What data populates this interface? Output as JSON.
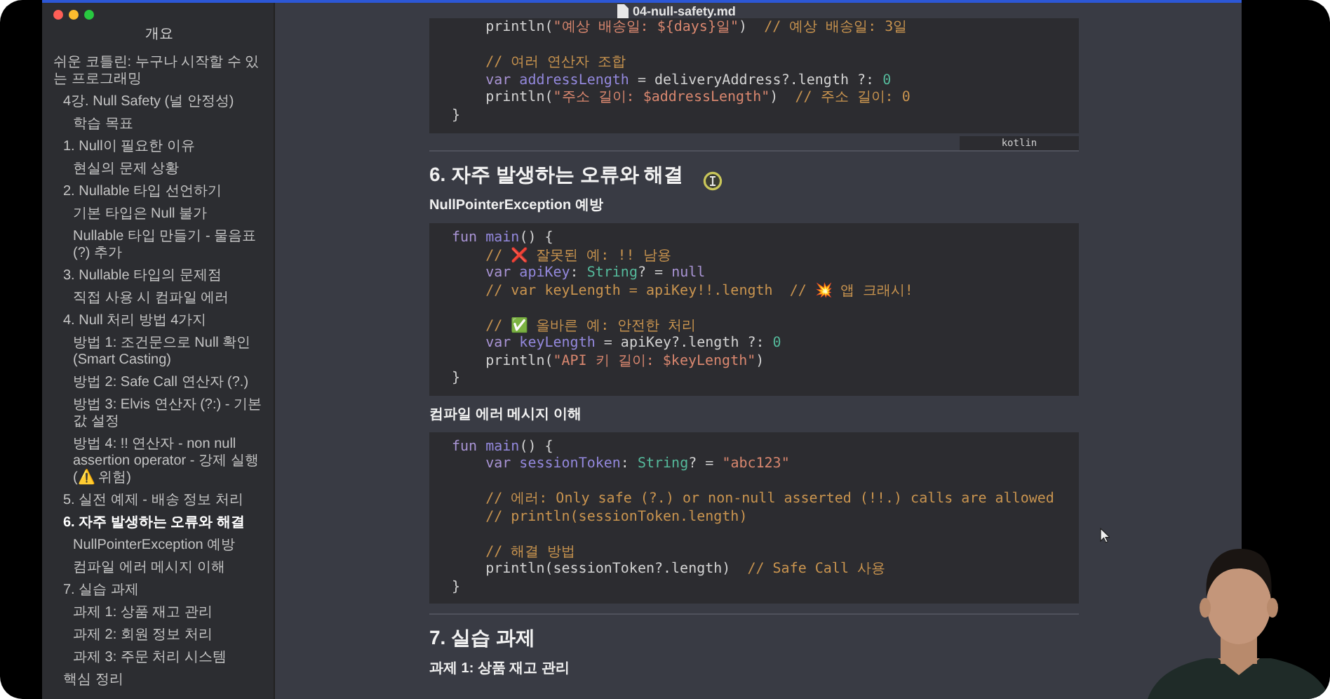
{
  "window": {
    "title": "04-null-safety.md"
  },
  "sidebar": {
    "title": "개요",
    "items": [
      {
        "label": "쉬운 코틀린: 누구나 시작할 수 있는 프로그래밍",
        "selected": false,
        "children": [
          {
            "label": "4강. Null Safety (널 안정성)",
            "selected": false,
            "children": [
              {
                "label": "학습 목표",
                "selected": false
              }
            ]
          },
          {
            "label": "1. Null이 필요한 이유",
            "selected": false,
            "children": [
              {
                "label": "현실의 문제 상황",
                "selected": false
              }
            ]
          },
          {
            "label": "2. Nullable 타입 선언하기",
            "selected": false,
            "children": [
              {
                "label": "기본 타입은 Null 불가",
                "selected": false
              },
              {
                "label": "Nullable 타입 만들기 - 물음표(?) 추가",
                "selected": false
              }
            ]
          },
          {
            "label": "3. Nullable 타입의 문제점",
            "selected": false,
            "children": [
              {
                "label": "직접 사용 시 컴파일 에러",
                "selected": false
              }
            ]
          },
          {
            "label": "4. Null 처리 방법 4가지",
            "selected": false,
            "children": [
              {
                "label": "방법 1: 조건문으로 Null 확인 (Smart Casting)",
                "selected": false
              },
              {
                "label": "방법 2: Safe Call 연산자 (?.)",
                "selected": false
              },
              {
                "label": "방법 3: Elvis 연산자 (?:) - 기본값 설정",
                "selected": false
              },
              {
                "label": "방법 4: !! 연산자 - non null assertion operator - 강제 실행 (⚠️ 위험)",
                "selected": false
              }
            ]
          },
          {
            "label": "5. 실전 예제 - 배송 정보 처리",
            "selected": false
          },
          {
            "label": "6. 자주 발생하는 오류와 해결",
            "selected": true,
            "children": [
              {
                "label": "NullPointerException 예방",
                "selected": false
              },
              {
                "label": "컴파일 에러 메시지 이해",
                "selected": false
              }
            ]
          },
          {
            "label": "7. 실습 과제",
            "selected": false,
            "children": [
              {
                "label": "과제 1: 상품 재고 관리",
                "selected": false
              },
              {
                "label": "과제 2: 회원 정보 처리",
                "selected": false
              },
              {
                "label": "과제 3: 주문 처리 시스템",
                "selected": false
              }
            ]
          },
          {
            "label": "핵심 정리",
            "selected": false
          }
        ]
      }
    ]
  },
  "content": [
    {
      "kind": "code",
      "language": "kotlin",
      "lines": [
        {
          "kind": "code",
          "tokens": [
            {
              "kind": "plain",
              "text": "    println("
            },
            {
              "kind": "str",
              "text": "\"예상 배송일: ${days}일\""
            },
            {
              "kind": "plain",
              "text": ")  "
            },
            {
              "kind": "comment",
              "text": "// 예상 배송일: 3일"
            }
          ]
        },
        {
          "kind": "blank"
        },
        {
          "kind": "code",
          "tokens": [
            {
              "kind": "comment",
              "text": "    // 여러 연산자 조합"
            }
          ]
        },
        {
          "kind": "code",
          "tokens": [
            {
              "kind": "kw",
              "text": "    var "
            },
            {
              "kind": "ident",
              "text": "addressLength"
            },
            {
              "kind": "plain",
              "text": " = deliveryAddress?.length ?: "
            },
            {
              "kind": "num",
              "text": "0"
            }
          ]
        },
        {
          "kind": "code",
          "tokens": [
            {
              "kind": "plain",
              "text": "    println("
            },
            {
              "kind": "str",
              "text": "\"주소 길이: $addressLength\""
            },
            {
              "kind": "plain",
              "text": ")  "
            },
            {
              "kind": "comment",
              "text": "// 주소 길이: 0"
            }
          ]
        },
        {
          "kind": "code",
          "tokens": [
            {
              "kind": "plain",
              "text": "}"
            }
          ]
        }
      ]
    },
    {
      "kind": "rule"
    },
    {
      "kind": "h2",
      "text": "6. 자주 발생하는 오류와 해결"
    },
    {
      "kind": "h3",
      "text": "NullPointerException 예방"
    },
    {
      "kind": "code",
      "lines": [
        {
          "kind": "code",
          "tokens": [
            {
              "kind": "kw",
              "text": "fun "
            },
            {
              "kind": "ident",
              "text": "main"
            },
            {
              "kind": "plain",
              "text": "() {"
            }
          ]
        },
        {
          "kind": "code",
          "tokens": [
            {
              "kind": "comment",
              "text": "    // ❌ 잘못된 예: !! 남용"
            }
          ]
        },
        {
          "kind": "code",
          "tokens": [
            {
              "kind": "kw",
              "text": "    var "
            },
            {
              "kind": "ident",
              "text": "apiKey"
            },
            {
              "kind": "plain",
              "text": ": "
            },
            {
              "kind": "type",
              "text": "String"
            },
            {
              "kind": "plain",
              "text": "? = "
            },
            {
              "kind": "kw",
              "text": "null"
            }
          ]
        },
        {
          "kind": "code",
          "tokens": [
            {
              "kind": "comment",
              "text": "    // var keyLength = apiKey!!.length  // 💥 앱 크래시!"
            }
          ]
        },
        {
          "kind": "blank"
        },
        {
          "kind": "code",
          "tokens": [
            {
              "kind": "comment",
              "text": "    // ✅ 올바른 예: 안전한 처리"
            }
          ]
        },
        {
          "kind": "code",
          "tokens": [
            {
              "kind": "kw",
              "text": "    var "
            },
            {
              "kind": "ident",
              "text": "keyLength"
            },
            {
              "kind": "plain",
              "text": " = apiKey?.length ?: "
            },
            {
              "kind": "num",
              "text": "0"
            }
          ]
        },
        {
          "kind": "code",
          "tokens": [
            {
              "kind": "plain",
              "text": "    println("
            },
            {
              "kind": "str",
              "text": "\"API 키 길이: $keyLength\""
            },
            {
              "kind": "plain",
              "text": ")"
            }
          ]
        },
        {
          "kind": "code",
          "tokens": [
            {
              "kind": "plain",
              "text": "}"
            }
          ]
        }
      ]
    },
    {
      "kind": "h3",
      "text": "컴파일 에러 메시지 이해"
    },
    {
      "kind": "code",
      "lines": [
        {
          "kind": "code",
          "tokens": [
            {
              "kind": "kw",
              "text": "fun "
            },
            {
              "kind": "ident",
              "text": "main"
            },
            {
              "kind": "plain",
              "text": "() {"
            }
          ]
        },
        {
          "kind": "code",
          "tokens": [
            {
              "kind": "kw",
              "text": "    var "
            },
            {
              "kind": "ident",
              "text": "sessionToken"
            },
            {
              "kind": "plain",
              "text": ": "
            },
            {
              "kind": "type",
              "text": "String"
            },
            {
              "kind": "plain",
              "text": "? = "
            },
            {
              "kind": "str",
              "text": "\"abc123\""
            }
          ]
        },
        {
          "kind": "blank"
        },
        {
          "kind": "code",
          "tokens": [
            {
              "kind": "comment",
              "text": "    // 에러: Only safe (?.) or non-null asserted (!!.) calls are allowed"
            }
          ]
        },
        {
          "kind": "code",
          "tokens": [
            {
              "kind": "comment",
              "text": "    // println(sessionToken.length)"
            }
          ]
        },
        {
          "kind": "blank"
        },
        {
          "kind": "code",
          "tokens": [
            {
              "kind": "comment",
              "text": "    // 해결 방법"
            }
          ]
        },
        {
          "kind": "code",
          "tokens": [
            {
              "kind": "plain",
              "text": "    println(sessionToken?.length)  "
            },
            {
              "kind": "comment",
              "text": "// Safe Call 사용"
            }
          ]
        },
        {
          "kind": "code",
          "tokens": [
            {
              "kind": "plain",
              "text": "}"
            }
          ]
        }
      ]
    },
    {
      "kind": "rule"
    },
    {
      "kind": "h2",
      "text": "7. 실습 과제"
    },
    {
      "kind": "h3",
      "text": "과제 1: 상품 재고 관리"
    }
  ]
}
